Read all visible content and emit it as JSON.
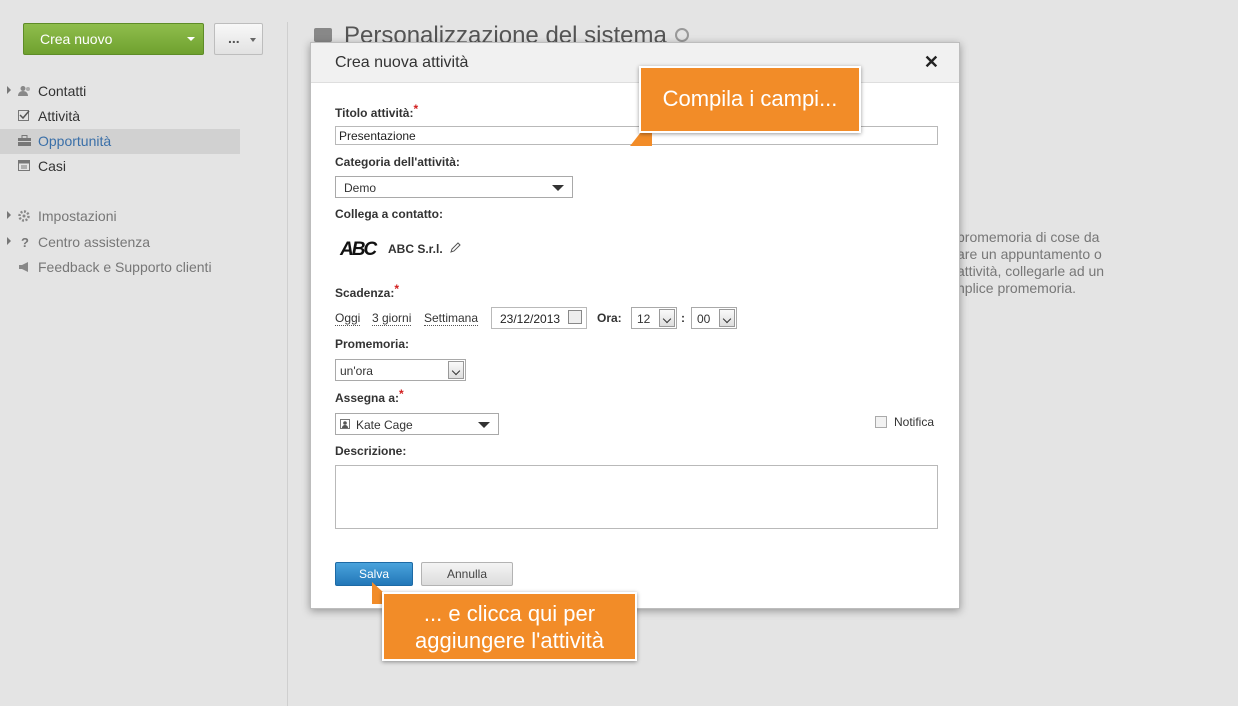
{
  "toolbar": {
    "create_label": "Crea nuovo",
    "more_label": "..."
  },
  "sidebar": {
    "items": [
      {
        "label": "Contatti",
        "icon": "contacts-icon"
      },
      {
        "label": "Attività",
        "icon": "tasks-icon"
      },
      {
        "label": "Opportunità",
        "icon": "briefcase-icon",
        "active": true
      },
      {
        "label": "Casi",
        "icon": "cases-icon"
      }
    ],
    "secondary": [
      {
        "label": "Impostazioni",
        "icon": "gear-icon"
      },
      {
        "label": "Centro assistenza",
        "icon": "question-icon"
      },
      {
        "label": "Feedback e Supporto clienti",
        "icon": "megaphone-icon"
      }
    ]
  },
  "page": {
    "title": "Personalizzazione del sistema",
    "bg_text": [
      "promemoria di cose da",
      "are un appuntamento o",
      " attività, collegarle ad un",
      "nplice promemoria."
    ]
  },
  "modal": {
    "title": "Crea nuova attività",
    "close": "✕",
    "fields": {
      "title_label": "Titolo attività:",
      "title_value": "Presentazione",
      "category_label": "Categoria dell'attività:",
      "category_value": "Demo",
      "contact_label": "Collega a contatto:",
      "contact_logo": "ABC",
      "contact_name": "ABC S.r.l.",
      "deadline_label": "Scadenza:",
      "quick_dates": [
        "Oggi",
        "3 giorni",
        "Settimana"
      ],
      "date_value": "23/12/2013",
      "time_label": "Ora:",
      "hour_value": "12",
      "time_sep": ":",
      "minute_value": "00",
      "reminder_label": "Promemoria:",
      "reminder_value": "un'ora",
      "assign_label": "Assegna a:",
      "assign_value": "Kate Cage",
      "notify_label": "Notifica",
      "description_label": "Descrizione:",
      "required_mark": "*"
    },
    "buttons": {
      "save": "Salva",
      "cancel": "Annulla"
    }
  },
  "callouts": {
    "fill": "Compila i campi...",
    "click_line1": "... e clicca qui per",
    "click_line2": "aggiungere l'attività"
  },
  "colors": {
    "accent_green": "#78aa36",
    "save_blue": "#2a80c2",
    "callout_orange": "#f28c28",
    "required_red": "#d21f1f"
  }
}
